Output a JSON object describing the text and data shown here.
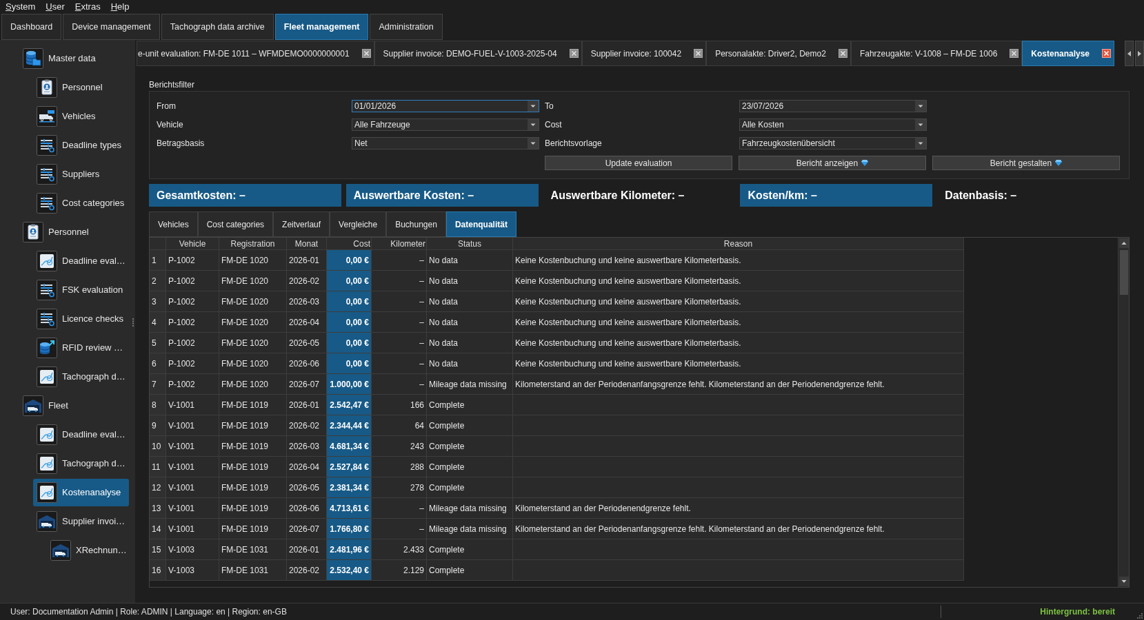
{
  "menu_bar": [
    "System",
    "User",
    "Extras",
    "Help"
  ],
  "main_tabs": [
    {
      "label": "Dashboard",
      "selected": false
    },
    {
      "label": "Device management",
      "selected": false
    },
    {
      "label": "Tachograph data archive",
      "selected": false
    },
    {
      "label": "Fleet management",
      "selected": true
    },
    {
      "label": "Administration",
      "selected": false
    }
  ],
  "sidebar": {
    "items": [
      {
        "label": "Master data",
        "kind": "database",
        "selected": false,
        "children": [
          {
            "label": "Personnel",
            "kind": "badge",
            "selected": false
          },
          {
            "label": "Vehicles",
            "kind": "vehicles",
            "selected": false
          },
          {
            "label": "Deadline types",
            "kind": "list",
            "selected": false
          },
          {
            "label": "Suppliers",
            "kind": "list",
            "selected": false
          },
          {
            "label": "Cost categories",
            "kind": "list",
            "selected": false
          }
        ]
      },
      {
        "label": "Personnel",
        "kind": "badge",
        "selected": false,
        "children": [
          {
            "label": "Deadline eval…",
            "kind": "chart",
            "selected": false
          },
          {
            "label": "FSK evaluation",
            "kind": "list",
            "selected": false
          },
          {
            "label": "Licence checks",
            "kind": "list",
            "selected": false
          },
          {
            "label": "RFID review …",
            "kind": "export",
            "selected": false
          },
          {
            "label": "Tachograph d…",
            "kind": "chart",
            "selected": false
          }
        ]
      },
      {
        "label": "Fleet",
        "kind": "garage",
        "selected": false,
        "children": [
          {
            "label": "Deadline eval…",
            "kind": "chart",
            "selected": false
          },
          {
            "label": "Tachograph d…",
            "kind": "chart",
            "selected": false
          },
          {
            "label": "Kostenanalyse",
            "kind": "chart",
            "selected": true
          },
          {
            "label": "Supplier invoi…",
            "kind": "garage",
            "selected": false,
            "children": [
              {
                "label": "XRechnun…",
                "kind": "garage",
                "selected": false
              }
            ]
          }
        ]
      }
    ]
  },
  "document_tabs": [
    {
      "label": "e-unit evaluation: FM-DE 1011 – WFMDEMO0000000001",
      "selected": false
    },
    {
      "label": "Supplier invoice: DEMO-FUEL-V-1003-2025-04",
      "selected": false
    },
    {
      "label": "Supplier invoice: 100042",
      "selected": false
    },
    {
      "label": "Personalakte: Driver2, Demo2",
      "selected": false
    },
    {
      "label": "Fahrzeugakte: V-1008 – FM-DE 1006",
      "selected": false
    },
    {
      "label": "Kostenanalyse",
      "selected": true
    }
  ],
  "report_filter": {
    "title": "Berichtsfilter",
    "fields": [
      {
        "label": "From",
        "value": "01/01/2026",
        "focused": true
      },
      {
        "label": "To",
        "value": "23/07/2026",
        "focused": false
      },
      {
        "label": "Vehicle",
        "value": "Alle Fahrzeuge",
        "focused": false
      },
      {
        "label": "Cost",
        "value": "Alle Kosten",
        "focused": false
      },
      {
        "label": "Betragsbasis",
        "value": "Net",
        "focused": false
      },
      {
        "label": "Berichtsvorlage",
        "value": "Fahrzeugkostenübersicht",
        "focused": false
      }
    ],
    "buttons": [
      {
        "label": "Update evaluation",
        "premium": false
      },
      {
        "label": "Bericht anzeigen",
        "premium": true
      },
      {
        "label": "Bericht gestalten",
        "premium": true
      }
    ]
  },
  "summary": [
    {
      "text": "Gesamtkosten: –",
      "highlighted": true
    },
    {
      "text": "Auswertbare Kosten: –",
      "highlighted": true
    },
    {
      "text": "Auswertbare Kilometer: –",
      "highlighted": false
    },
    {
      "text": "Kosten/km: –",
      "highlighted": true
    },
    {
      "text": "Datenbasis: –",
      "highlighted": false
    }
  ],
  "result_tabs": [
    {
      "label": "Vehicles",
      "selected": false
    },
    {
      "label": "Cost categories",
      "selected": false
    },
    {
      "label": "Zeitverlauf",
      "selected": false
    },
    {
      "label": "Vergleiche",
      "selected": false
    },
    {
      "label": "Buchungen",
      "selected": false
    },
    {
      "label": "Datenqualität",
      "selected": true
    }
  ],
  "table": {
    "columns": [
      "Vehicle",
      "Registration",
      "Monat",
      "Cost",
      "Kilometer",
      "Status",
      "Reason"
    ],
    "rows": [
      {
        "number": "1",
        "vehicle": "P-1002",
        "registration": "FM-DE 1020",
        "monat": "2026-01",
        "cost": "0,00 €",
        "kilometer": "–",
        "status": "No data",
        "reason": "Keine Kostenbuchung und keine auswertbare Kilometerbasis."
      },
      {
        "number": "2",
        "vehicle": "P-1002",
        "registration": "FM-DE 1020",
        "monat": "2026-02",
        "cost": "0,00 €",
        "kilometer": "–",
        "status": "No data",
        "reason": "Keine Kostenbuchung und keine auswertbare Kilometerbasis."
      },
      {
        "number": "3",
        "vehicle": "P-1002",
        "registration": "FM-DE 1020",
        "monat": "2026-03",
        "cost": "0,00 €",
        "kilometer": "–",
        "status": "No data",
        "reason": "Keine Kostenbuchung und keine auswertbare Kilometerbasis."
      },
      {
        "number": "4",
        "vehicle": "P-1002",
        "registration": "FM-DE 1020",
        "monat": "2026-04",
        "cost": "0,00 €",
        "kilometer": "–",
        "status": "No data",
        "reason": "Keine Kostenbuchung und keine auswertbare Kilometerbasis."
      },
      {
        "number": "5",
        "vehicle": "P-1002",
        "registration": "FM-DE 1020",
        "monat": "2026-05",
        "cost": "0,00 €",
        "kilometer": "–",
        "status": "No data",
        "reason": "Keine Kostenbuchung und keine auswertbare Kilometerbasis."
      },
      {
        "number": "6",
        "vehicle": "P-1002",
        "registration": "FM-DE 1020",
        "monat": "2026-06",
        "cost": "0,00 €",
        "kilometer": "–",
        "status": "No data",
        "reason": "Keine Kostenbuchung und keine auswertbare Kilometerbasis."
      },
      {
        "number": "7",
        "vehicle": "P-1002",
        "registration": "FM-DE 1020",
        "monat": "2026-07",
        "cost": "1.000,00 €",
        "kilometer": "–",
        "status": "Mileage data missing",
        "reason": "Kilometerstand an der Periodenanfangsgrenze fehlt. Kilometerstand an der Periodenendgrenze fehlt."
      },
      {
        "number": "8",
        "vehicle": "V-1001",
        "registration": "FM-DE 1019",
        "monat": "2026-01",
        "cost": "2.542,47 €",
        "kilometer": "166",
        "status": "Complete"
      },
      {
        "number": "9",
        "vehicle": "V-1001",
        "registration": "FM-DE 1019",
        "monat": "2026-02",
        "cost": "2.344,44 €",
        "kilometer": "64",
        "status": "Complete"
      },
      {
        "number": "10",
        "vehicle": "V-1001",
        "registration": "FM-DE 1019",
        "monat": "2026-03",
        "cost": "4.681,34 €",
        "kilometer": "243",
        "status": "Complete"
      },
      {
        "number": "11",
        "vehicle": "V-1001",
        "registration": "FM-DE 1019",
        "monat": "2026-04",
        "cost": "2.527,84 €",
        "kilometer": "288",
        "status": "Complete"
      },
      {
        "number": "12",
        "vehicle": "V-1001",
        "registration": "FM-DE 1019",
        "monat": "2026-05",
        "cost": "2.381,34 €",
        "kilometer": "278",
        "status": "Complete"
      },
      {
        "number": "13",
        "vehicle": "V-1001",
        "registration": "FM-DE 1019",
        "monat": "2026-06",
        "cost": "4.713,61 €",
        "kilometer": "–",
        "status": "Mileage data missing",
        "reason": "Kilometerstand an der Periodenendgrenze fehlt."
      },
      {
        "number": "14",
        "vehicle": "V-1001",
        "registration": "FM-DE 1019",
        "monat": "2026-07",
        "cost": "1.766,80 €",
        "kilometer": "–",
        "status": "Mileage data missing",
        "reason": "Kilometerstand an der Periodenanfangsgrenze fehlt. Kilometerstand an der Periodenendgrenze fehlt."
      },
      {
        "number": "15",
        "vehicle": "V-1003",
        "registration": "FM-DE 1031",
        "monat": "2026-01",
        "cost": "2.481,96 €",
        "kilometer": "2.433",
        "status": "Complete"
      },
      {
        "number": "16",
        "vehicle": "V-1003",
        "registration": "FM-DE 1031",
        "monat": "2026-02",
        "cost": "2.532,40 €",
        "kilometer": "2.129",
        "status": "Complete"
      }
    ]
  },
  "status_bar": {
    "text": "User: Documentation Admin | Role: ADMIN | Language: en | Region: en-GB",
    "background_status": "Hintergrund: bereit"
  }
}
